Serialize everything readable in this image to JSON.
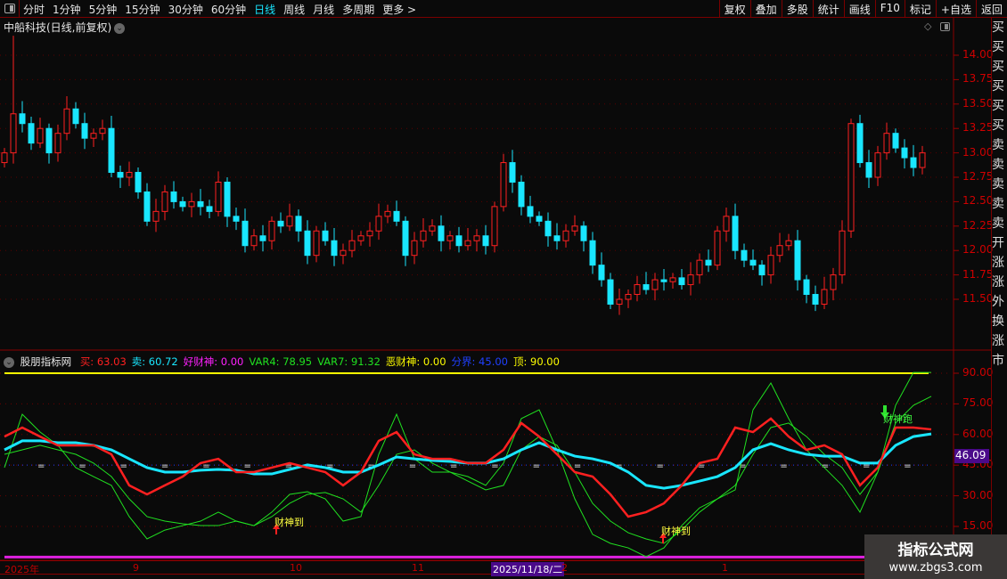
{
  "toolbar": {
    "periods": [
      "分时",
      "1分钟",
      "5分钟",
      "15分钟",
      "30分钟",
      "60分钟",
      "日线",
      "周线",
      "月线",
      "多周期",
      "更多 >"
    ],
    "active_period": "日线",
    "right_buttons": [
      "复权",
      "叠加",
      "多股",
      "统计",
      "画线",
      "F10",
      "标记",
      "+自选",
      "返回"
    ]
  },
  "chart_title": "中船科技(日线,前复权)",
  "price_axis": [
    "14.00",
    "13.75",
    "13.50",
    "13.25",
    "13.00",
    "12.75",
    "12.50",
    "12.25",
    "12.00",
    "11.75",
    "11.50"
  ],
  "price_data": {
    "first_open": 12.9,
    "closes": [
      13.0,
      13.4,
      13.3,
      13.1,
      13.25,
      13.0,
      13.2,
      13.45,
      13.3,
      13.15,
      13.2,
      13.25,
      12.8,
      12.75,
      12.8,
      12.6,
      12.3,
      12.4,
      12.6,
      12.5,
      12.45,
      12.5,
      12.45,
      12.4,
      12.7,
      12.35,
      12.3,
      12.05,
      12.15,
      12.1,
      12.3,
      12.25,
      12.35,
      12.2,
      11.95,
      12.2,
      12.1,
      11.95,
      12.0,
      12.1,
      12.15,
      12.2,
      12.35,
      12.4,
      12.3,
      11.95,
      12.1,
      12.2,
      12.25,
      12.1,
      12.15,
      12.05,
      12.1,
      12.15,
      12.05,
      12.45,
      12.9,
      12.7,
      12.45,
      12.35,
      12.3,
      12.15,
      12.1,
      12.2,
      12.25,
      12.1,
      11.85,
      11.7,
      11.45,
      11.5,
      11.55,
      11.65,
      11.6,
      11.7,
      11.68,
      11.72,
      11.65,
      11.75,
      11.9,
      11.85,
      12.2,
      12.35,
      12.0,
      11.9,
      11.85,
      11.75,
      11.95,
      12.05,
      12.1,
      11.7,
      11.55,
      11.45,
      11.6,
      11.75,
      12.2,
      13.3,
      12.9,
      12.75,
      13.0,
      13.2,
      13.05,
      12.95,
      12.85,
      13.0
    ],
    "spike_high": 14.2
  },
  "indicator": {
    "name": "股朋指标网",
    "values": [
      {
        "label": "买: 63.03",
        "color": "#ff2020"
      },
      {
        "label": "卖: 60.72",
        "color": "#19e6ff"
      },
      {
        "label": "好财神: 0.00",
        "color": "#ff20ff"
      },
      {
        "label": "VAR4: 78.95",
        "color": "#20e020"
      },
      {
        "label": "VAR7: 91.32",
        "color": "#20e020"
      },
      {
        "label": "恶财神: 0.00",
        "color": "#ffff00"
      },
      {
        "label": "分界: 45.00",
        "color": "#2040ff"
      },
      {
        "label": "顶: 90.00",
        "color": "#ffff00"
      }
    ],
    "axis": [
      "90.00",
      "75.00",
      "60.00",
      "45.00",
      "30.00",
      "15.00"
    ],
    "current_value": "46.09",
    "series": {
      "buy": [
        59,
        63.4,
        59,
        54.7,
        54.7,
        54.7,
        50.3,
        35.1,
        30.7,
        35.1,
        39.4,
        46,
        48.1,
        41.6,
        41.6,
        43.8,
        46,
        43.8,
        41.6,
        35.1,
        41.6,
        56.9,
        61.2,
        50.3,
        48.1,
        48.1,
        46,
        46,
        52.5,
        65.6,
        59,
        50.3,
        41.6,
        39.4,
        30.7,
        19.8,
        22,
        26.3,
        35.1,
        46,
        48.1,
        63.4,
        61.2,
        67.8,
        59,
        52.5,
        54.7,
        50.3,
        35.1,
        43.8,
        63.4,
        63.4,
        62.5
      ],
      "sell": [
        52.5,
        56.9,
        56.9,
        56,
        56,
        54.7,
        52.5,
        48.1,
        43.8,
        41.6,
        41.6,
        42.5,
        42.9,
        42.5,
        40.7,
        40.7,
        42.9,
        45.1,
        43.8,
        41.6,
        41.6,
        45.1,
        49,
        48.1,
        47.3,
        46.8,
        46,
        46,
        48.1,
        52.5,
        56,
        52.5,
        49.4,
        48.1,
        46,
        41.6,
        35.1,
        33.7,
        35.1,
        37.2,
        39.4,
        43.8,
        52.5,
        55.5,
        52.5,
        50.3,
        49.4,
        49.4,
        46,
        46,
        54.7,
        59,
        60.3
      ],
      "var4": [
        50.3,
        52.5,
        54.7,
        52.5,
        50.3,
        46,
        39.4,
        28.5,
        19.8,
        17.6,
        16.3,
        15.4,
        15.4,
        17.6,
        15.4,
        19.8,
        26.3,
        30.7,
        31.6,
        28.5,
        22,
        35.1,
        50.3,
        52.5,
        46,
        41.6,
        37.2,
        32.9,
        35.1,
        52.5,
        59,
        54.7,
        41.6,
        26.3,
        17.6,
        11.9,
        8.9,
        6.7,
        13.2,
        22,
        28.5,
        35.1,
        50.3,
        63.4,
        65.6,
        59,
        50.3,
        43.8,
        30.7,
        41.6,
        65.6,
        74.3,
        78.7
      ],
      "var7": [
        43.8,
        69.9,
        61.2,
        54.7,
        43.8,
        39.4,
        35.1,
        19.8,
        8.9,
        13.2,
        15.4,
        17.6,
        22,
        17.6,
        15.4,
        22,
        30.7,
        32,
        28.5,
        17.6,
        19.8,
        50.3,
        69.9,
        48.1,
        41.6,
        41.6,
        39.4,
        35.1,
        46,
        67.8,
        72.1,
        52.5,
        28.5,
        11.1,
        6.7,
        4.5,
        0.2,
        4.5,
        15.4,
        24.1,
        28.5,
        32.9,
        72.1,
        85.2,
        67.8,
        52.5,
        43.8,
        35.1,
        22,
        41.6,
        74.3,
        90.4,
        90.4
      ]
    },
    "top": 90,
    "divider": 45,
    "signals": [
      {
        "text": "财神到",
        "type": "buy"
      },
      {
        "text": "财神到",
        "type": "buy"
      },
      {
        "text": "财神跑",
        "type": "sell"
      }
    ]
  },
  "time_axis": [
    "2025年",
    "9",
    "10",
    "11",
    "2025/11/18/二",
    "2",
    "1"
  ],
  "side_strip": [
    "买",
    "买",
    "买",
    "买",
    "买",
    "买",
    "卖",
    "卖",
    "卖",
    "卖",
    "卖",
    "开",
    "涨",
    "涨",
    "外",
    "换",
    "涨",
    "市"
  ],
  "watermark": {
    "title": "指标公式网",
    "url": "www.zbgs3.com"
  }
}
